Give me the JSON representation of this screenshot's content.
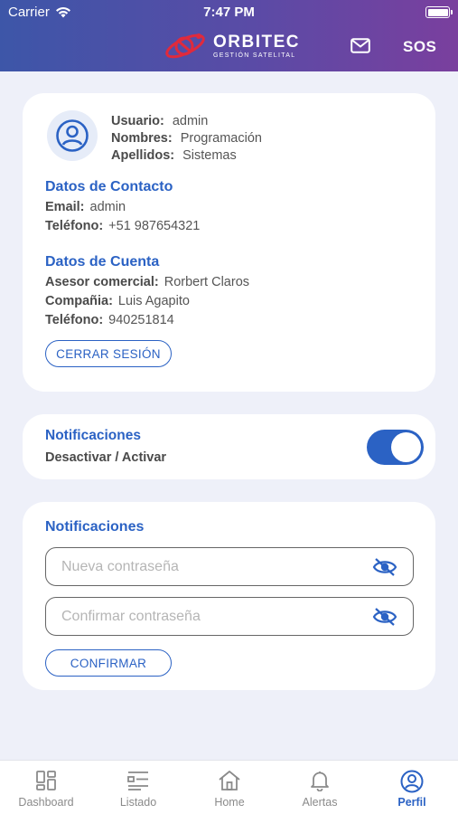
{
  "status_bar": {
    "carrier": "Carrier",
    "time": "7:47 PM"
  },
  "header": {
    "brand": "ORBITEC",
    "brand_sub": "GESTIÓN SATELITAL",
    "sos": "SOS"
  },
  "profile": {
    "user_label": "Usuario:",
    "user_value": "admin",
    "names_label": "Nombres:",
    "names_value": "Programación",
    "surnames_label": "Apellidos:",
    "surnames_value": "Sistemas"
  },
  "contact": {
    "title": "Datos de Contacto",
    "email_label": "Email:",
    "email_value": "admin",
    "phone_label": "Teléfono:",
    "phone_value": "+51 987654321"
  },
  "account": {
    "title": "Datos de Cuenta",
    "advisor_label": "Asesor comercial:",
    "advisor_value": "Rorbert Claros",
    "company_label": "Compañia:",
    "company_value": "Luis Agapito",
    "phone_label": "Teléfono:",
    "phone_value": "940251814"
  },
  "logout_label": "CERRAR SESIÓN",
  "notifications": {
    "title": "Notificaciones",
    "subtitle": "Desactivar / Activar",
    "enabled": true
  },
  "password": {
    "title": "Notificaciones",
    "new_placeholder": "Nueva contraseña",
    "confirm_placeholder": "Confirmar contraseña",
    "confirm_button": "CONFIRMAR"
  },
  "tabs": [
    {
      "label": "Dashboard",
      "icon": "dashboard-icon"
    },
    {
      "label": "Listado",
      "icon": "list-icon"
    },
    {
      "label": "Home",
      "icon": "home-icon"
    },
    {
      "label": "Alertas",
      "icon": "bell-icon"
    },
    {
      "label": "Perfil",
      "icon": "user-circle-icon",
      "active": true
    }
  ],
  "colors": {
    "accent": "#2b62c4",
    "header_start": "#3d56a8",
    "header_end": "#7a3f9e",
    "logo_red": "#e02a3c"
  }
}
